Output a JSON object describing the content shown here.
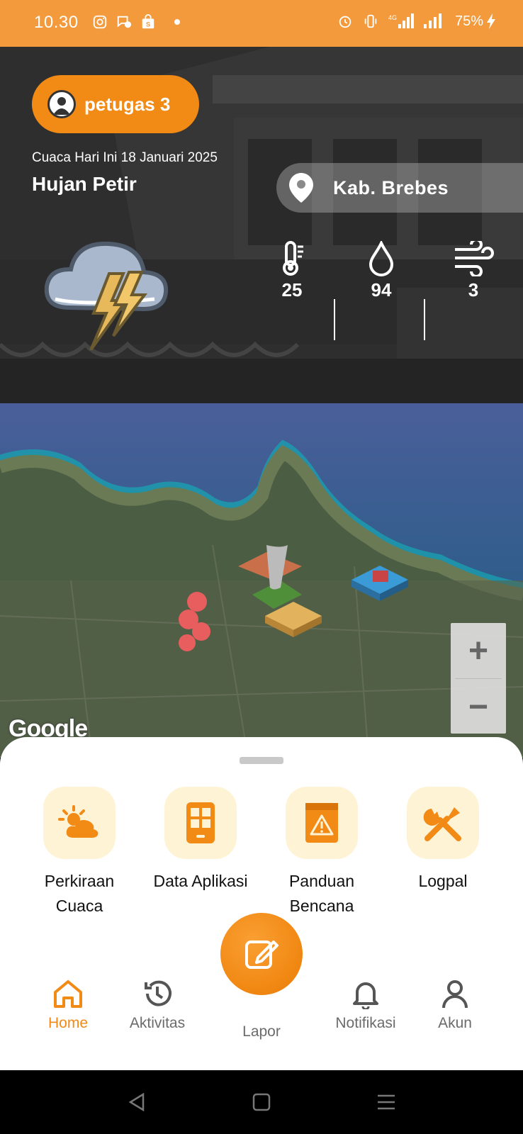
{
  "status_bar": {
    "time": "10.30",
    "network_label": "4G",
    "battery": "75%"
  },
  "header": {
    "username": "petugas 3",
    "date_label": "Cuaca Hari Ini 18 Januari 2025",
    "condition": "Hujan Petir",
    "location": "Kab. Brebes",
    "stats": {
      "temperature": "25",
      "humidity": "94",
      "wind": "3"
    }
  },
  "map": {
    "attribution": "Google",
    "zoom_in": "+",
    "zoom_out": "−"
  },
  "menu": {
    "items": [
      {
        "label_line1": "Perkiraan",
        "label_line2": "Cuaca",
        "icon": "weather-sun-cloud-icon"
      },
      {
        "label_line1": "Data Aplikasi",
        "label_line2": "",
        "icon": "phone-app-grid-icon"
      },
      {
        "label_line1": "Panduan",
        "label_line2": "Bencana",
        "icon": "warning-book-icon"
      },
      {
        "label_line1": "Logpal",
        "label_line2": "",
        "icon": "tools-icon"
      }
    ]
  },
  "nav": {
    "home": "Home",
    "aktivitas": "Aktivitas",
    "lapor": "Lapor",
    "notifikasi": "Notifikasi",
    "akun": "Akun"
  },
  "colors": {
    "accent": "#f28a16",
    "status_bar": "#f39b3c",
    "menu_icon_bg": "#fff3d6",
    "nav_inactive": "#6b6b6b"
  }
}
